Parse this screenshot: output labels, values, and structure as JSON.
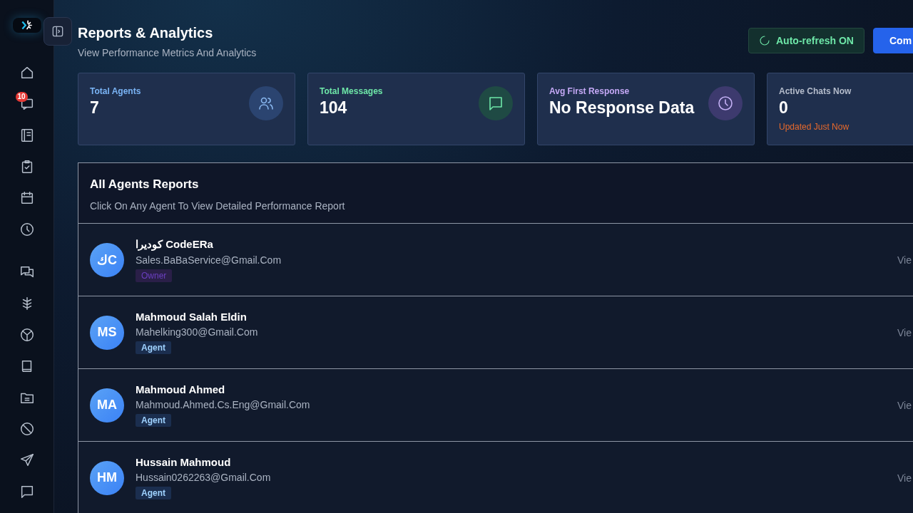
{
  "sidebar": {
    "items": [
      {
        "kind": "home"
      },
      {
        "kind": "chat",
        "badge": "10"
      },
      {
        "kind": "notebook"
      },
      {
        "kind": "clipboard"
      },
      {
        "kind": "calendar"
      },
      {
        "kind": "clock"
      },
      {
        "kind": "chats"
      },
      {
        "kind": "tree"
      },
      {
        "kind": "peace"
      },
      {
        "kind": "book"
      },
      {
        "kind": "folder"
      },
      {
        "kind": "block"
      },
      {
        "kind": "send"
      },
      {
        "kind": "message"
      }
    ]
  },
  "header": {
    "title": "Reports & Analytics",
    "subtitle": "View Performance Metrics And Analytics",
    "buttons": [
      {
        "kind": "toggle",
        "label": "Auto-refresh ON"
      },
      {
        "kind": "primary",
        "label": "Com"
      }
    ]
  },
  "stats": [
    {
      "label": "Total Agents",
      "value": "7",
      "color": "#7ab4f5",
      "kind": "users"
    },
    {
      "label": "Total Messages",
      "value": "104",
      "color": "#6ee7a8",
      "kind": "message"
    },
    {
      "label": "Avg First Response",
      "value": "No Response Data",
      "color": "#c4a8f5",
      "kind": "clock"
    },
    {
      "label": "Active Chats Now",
      "value": "0",
      "color": "#b4bccb",
      "note": "Updated Just Now"
    }
  ],
  "agents": {
    "title": "All Agents Reports",
    "subtitle": "Click On Any Agent To View Detailed Performance Report",
    "rows": [
      {
        "initials": "كC",
        "name": "كوديرا CodeERa",
        "email": "Sales.BaBaService@Gmail.Com",
        "role": "Owner",
        "kind": "owner",
        "action": "Vie"
      },
      {
        "initials": "MS",
        "name": "Mahmoud Salah Eldin",
        "email": "Mahelking300@Gmail.Com",
        "role": "Agent",
        "kind": "agent",
        "action": "Vie"
      },
      {
        "initials": "MA",
        "name": "Mahmoud Ahmed",
        "email": "Mahmoud.Ahmed.Cs.Eng@Gmail.Com",
        "role": "Agent",
        "kind": "agent",
        "action": "Vie"
      },
      {
        "initials": "HM",
        "name": "Hussain Mahmoud",
        "email": "Hussain0262263@Gmail.Com",
        "role": "Agent",
        "kind": "agent",
        "action": "Vie"
      }
    ]
  }
}
